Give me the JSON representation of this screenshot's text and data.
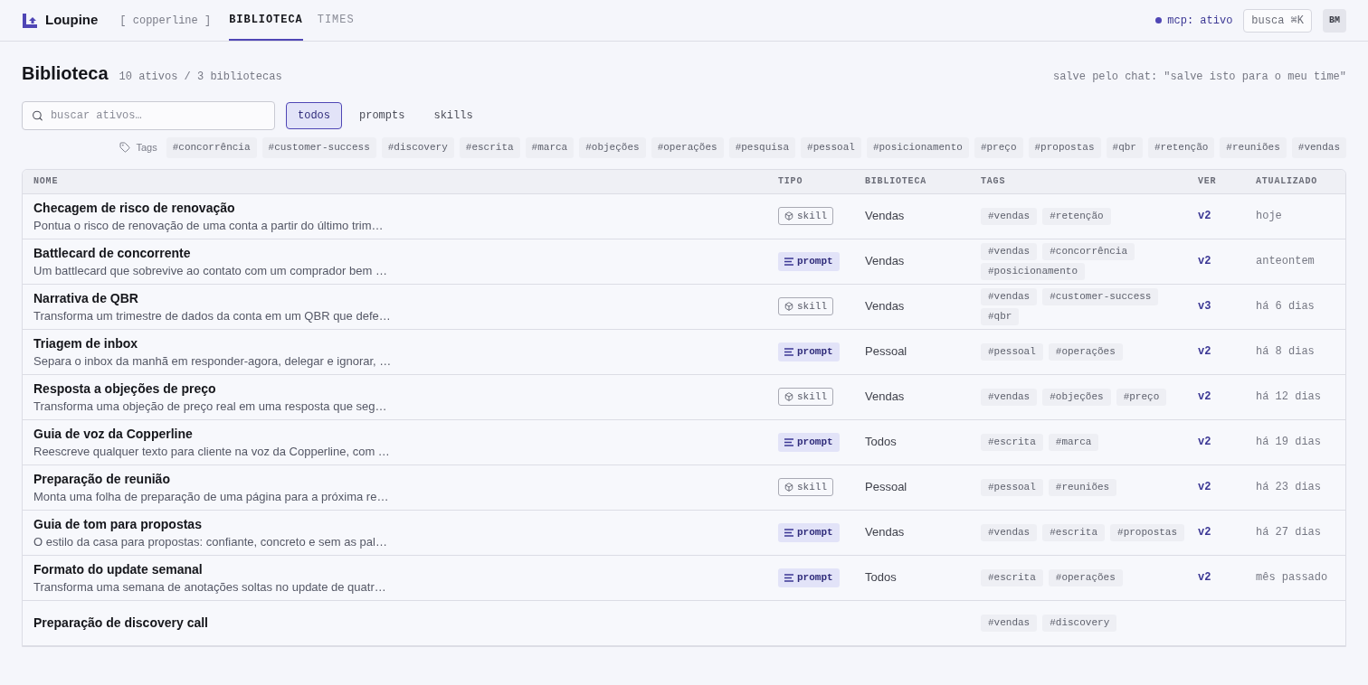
{
  "header": {
    "brand": "Loupine",
    "workspace": "[ copperline ]",
    "tabs": [
      {
        "label": "BIBLIOTECA",
        "selected": true
      },
      {
        "label": "TIMES",
        "selected": false
      }
    ],
    "mcp_status": {
      "label": "mcp: ativo",
      "on": true
    },
    "search_button": "busca ⌘K",
    "avatar": "BM"
  },
  "page": {
    "title": "Biblioteca",
    "subtitle": "10 ativos / 3 bibliotecas",
    "hint": "salve pelo chat: \"salve isto para o meu time\""
  },
  "search": {
    "placeholder": "buscar ativos…"
  },
  "filters": [
    {
      "label": "todos",
      "selected": true
    },
    {
      "label": "prompts",
      "selected": false
    },
    {
      "label": "skills",
      "selected": false
    }
  ],
  "tag_filter": {
    "label": "Tags",
    "tags": [
      "#concorrência",
      "#customer-success",
      "#discovery",
      "#escrita",
      "#marca",
      "#objeções",
      "#operações",
      "#pesquisa",
      "#pessoal",
      "#posicionamento",
      "#preço",
      "#propostas",
      "#qbr",
      "#retenção",
      "#reuniões",
      "#vendas"
    ]
  },
  "table": {
    "columns": [
      "NOME",
      "TIPO",
      "BIBLIOTECA",
      "TAGS",
      "VER",
      "ATUALIZADO"
    ],
    "rows": [
      {
        "name": "Checagem de risco de renovação",
        "description": "Pontua o risco de renovação de uma conta a partir do último trim…",
        "type": {
          "kind": "skill",
          "label": "skill"
        },
        "library": "Vendas",
        "tags": [
          "#vendas",
          "#retenção"
        ],
        "version": "v2",
        "updated": "hoje"
      },
      {
        "name": "Battlecard de concorrente",
        "description": "Um battlecard que sobrevive ao contato com um comprador bem …",
        "type": {
          "kind": "prompt",
          "label": "prompt"
        },
        "library": "Vendas",
        "tags": [
          "#vendas",
          "#concorrência",
          "#posicionamento"
        ],
        "version": "v2",
        "updated": "anteontem"
      },
      {
        "name": "Narrativa de QBR",
        "description": "Transforma um trimestre de dados da conta em um QBR que defe…",
        "type": {
          "kind": "skill",
          "label": "skill"
        },
        "library": "Vendas",
        "tags": [
          "#vendas",
          "#customer-success",
          "#qbr"
        ],
        "version": "v3",
        "updated": "há 6 dias"
      },
      {
        "name": "Triagem de inbox",
        "description": "Separa o inbox da manhã em responder-agora, delegar e ignorar, …",
        "type": {
          "kind": "prompt",
          "label": "prompt"
        },
        "library": "Pessoal",
        "tags": [
          "#pessoal",
          "#operações"
        ],
        "version": "v2",
        "updated": "há 8 dias"
      },
      {
        "name": "Resposta a objeções de preço",
        "description": "Transforma uma objeção de preço real em uma resposta que seg…",
        "type": {
          "kind": "skill",
          "label": "skill"
        },
        "library": "Vendas",
        "tags": [
          "#vendas",
          "#objeções",
          "#preço"
        ],
        "version": "v2",
        "updated": "há 12 dias"
      },
      {
        "name": "Guia de voz da Copperline",
        "description": "Reescreve qualquer texto para cliente na voz da Copperline, com …",
        "type": {
          "kind": "prompt",
          "label": "prompt"
        },
        "library": "Todos",
        "tags": [
          "#escrita",
          "#marca"
        ],
        "version": "v2",
        "updated": "há 19 dias"
      },
      {
        "name": "Preparação de reunião",
        "description": "Monta uma folha de preparação de uma página para a próxima re…",
        "type": {
          "kind": "skill",
          "label": "skill"
        },
        "library": "Pessoal",
        "tags": [
          "#pessoal",
          "#reuniões"
        ],
        "version": "v2",
        "updated": "há 23 dias"
      },
      {
        "name": "Guia de tom para propostas",
        "description": "O estilo da casa para propostas: confiante, concreto e sem as pal…",
        "type": {
          "kind": "prompt",
          "label": "prompt"
        },
        "library": "Vendas",
        "tags": [
          "#vendas",
          "#escrita",
          "#propostas"
        ],
        "version": "v2",
        "updated": "há 27 dias"
      },
      {
        "name": "Formato do update semanal",
        "description": "Transforma uma semana de anotações soltas no update de quatr…",
        "type": {
          "kind": "prompt",
          "label": "prompt"
        },
        "library": "Todos",
        "tags": [
          "#escrita",
          "#operações"
        ],
        "version": "v2",
        "updated": "mês passado"
      },
      {
        "name": "Preparação de discovery call",
        "tags": [
          "#vendas",
          "#discovery"
        ]
      }
    ]
  }
}
